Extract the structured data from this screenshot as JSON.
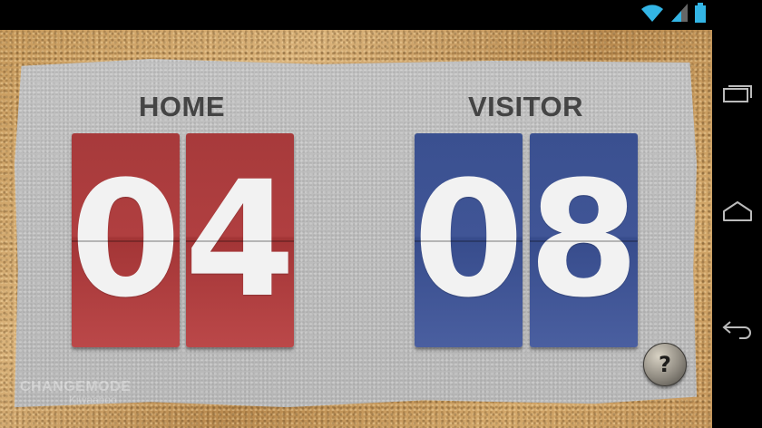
{
  "scoreboard": {
    "home": {
      "label": "HOME",
      "score_digits": [
        "0",
        "4"
      ],
      "card_color": "#b03f40"
    },
    "visitor": {
      "label": "VISITOR",
      "score_digits": [
        "0",
        "8"
      ],
      "card_color": "#405596"
    }
  },
  "branding": {
    "watermark": "CHANGEMODE",
    "watermark_sub": "Kiwaaboo"
  },
  "help": {
    "glyph": "?",
    "icon": "volleyball-help-icon"
  },
  "status_bar": {
    "icons": [
      "wifi-icon",
      "signal-icon",
      "battery-icon"
    ]
  },
  "nav_bar": {
    "buttons": [
      "recent-apps-icon",
      "home-icon",
      "back-icon"
    ]
  }
}
